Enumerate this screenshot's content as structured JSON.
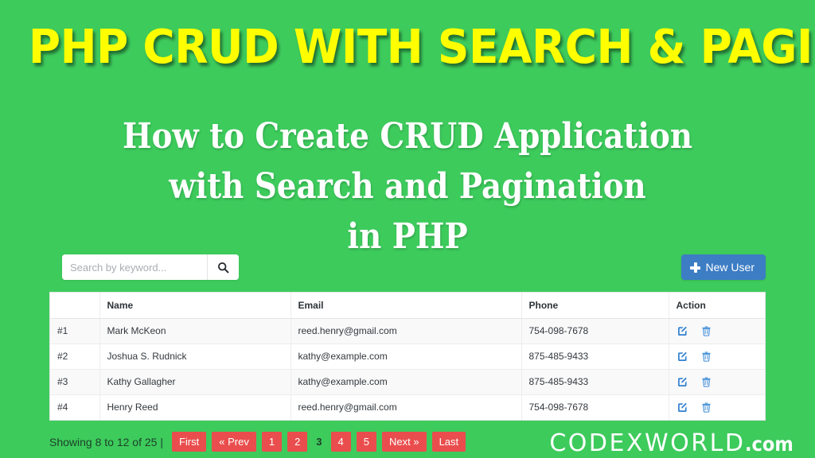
{
  "banner": {
    "headline": "PHP CRUD WITH SEARCH & PAGINATION",
    "subhead_line1": "How to Create CRUD Application",
    "subhead_line2": "with Search and Pagination",
    "subhead_line3": "in PHP",
    "background_color": "#3dcb5c",
    "headline_color": "#ffff00",
    "subhead_color": "#ffffff"
  },
  "toolbar": {
    "search_placeholder": "Search by keyword...",
    "search_value": "",
    "search_icon": "search-icon",
    "new_user_label": "New User",
    "new_user_icon": "plus-icon",
    "new_user_color": "#3c7dc4"
  },
  "table": {
    "headers": [
      "",
      "Name",
      "Email",
      "Phone",
      "Action"
    ],
    "rows": [
      {
        "id": "#1",
        "name": "Mark McKeon",
        "email": "reed.henry@gmail.com",
        "phone": "754-098-7678",
        "edit_icon": "edit-icon",
        "delete_icon": "trash-icon"
      },
      {
        "id": "#2",
        "name": "Joshua S. Rudnick",
        "email": "kathy@example.com",
        "phone": "875-485-9433",
        "edit_icon": "edit-icon",
        "delete_icon": "trash-icon"
      },
      {
        "id": "#3",
        "name": "Kathy Gallagher",
        "email": "kathy@example.com",
        "phone": "875-485-9433",
        "edit_icon": "edit-icon",
        "delete_icon": "trash-icon"
      },
      {
        "id": "#4",
        "name": "Henry Reed",
        "email": "reed.henry@gmail.com",
        "phone": "754-098-7678",
        "edit_icon": "edit-icon",
        "delete_icon": "trash-icon"
      }
    ]
  },
  "pagination": {
    "info": "Showing 8 to 12 of 25 |",
    "first": "First",
    "prev": "« Prev",
    "pages": [
      "1",
      "2",
      "3",
      "4",
      "5"
    ],
    "current_page": "3",
    "next": "Next »",
    "last": "Last",
    "button_color": "#ea4d4d"
  },
  "logo": {
    "main": "CODEXWORLD",
    "tld": ".com"
  }
}
